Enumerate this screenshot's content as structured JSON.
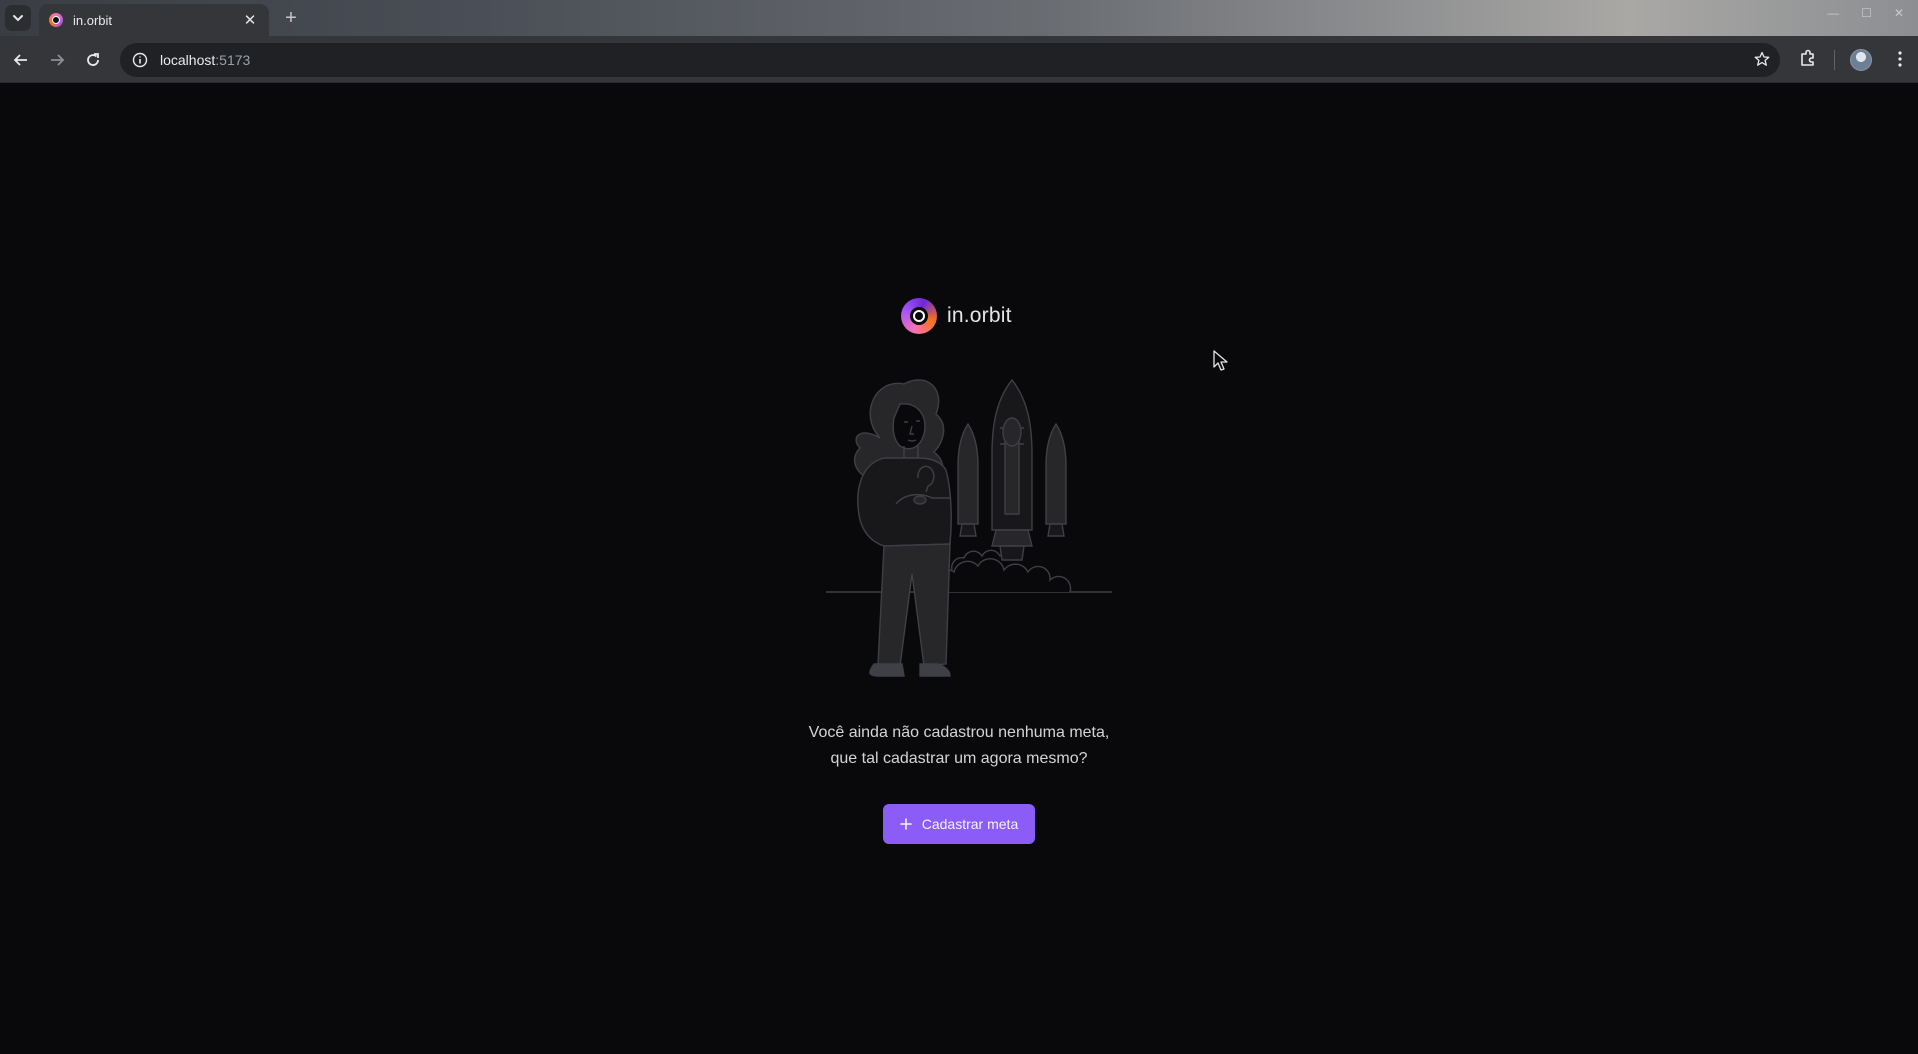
{
  "browser": {
    "tab": {
      "title": "in.orbit",
      "favicon": "in-orbit-logo"
    },
    "url": {
      "host": "localhost",
      "port": ":5173"
    },
    "colors": {
      "titlebar": "#3a3d44",
      "toolbar": "#35363a",
      "omnibox": "#202124"
    }
  },
  "app": {
    "brand": {
      "name": "in.orbit"
    },
    "empty_state": {
      "line1": "Você ainda não cadastrou nenhuma meta,",
      "line2": "que tal cadastrar um agora mesmo?"
    },
    "cta": {
      "icon": "plus-icon",
      "label": "Cadastrar meta"
    },
    "colors": {
      "background": "#09090b",
      "accent": "#8b5cf6",
      "text": "#d4d4d8"
    }
  }
}
